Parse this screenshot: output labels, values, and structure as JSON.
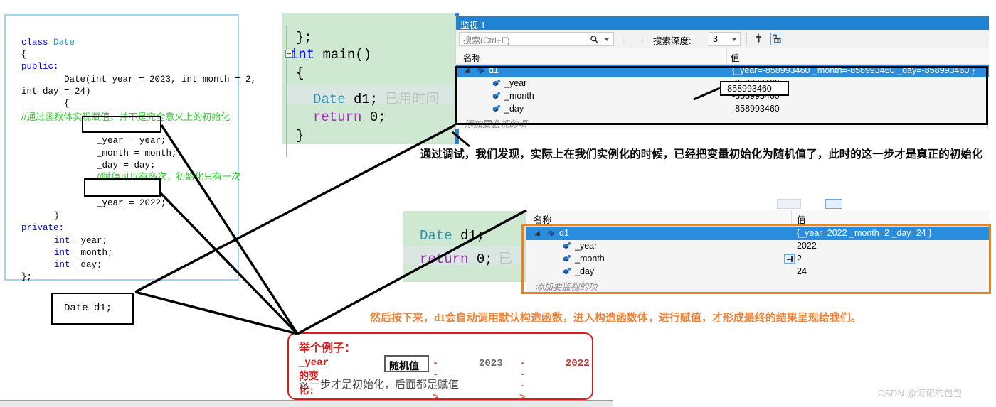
{
  "code_left": {
    "line1_kw": "class",
    "line1_type": " Date",
    "line2": "{",
    "line3": "public:",
    "line4": "        Date(int year = 2023, int month = 2,",
    "line5": "int day = 24)",
    "line6": "        {",
    "comment1": "//通过函数体实现赋值，并不是完全意义上的初始化",
    "assign_year": "_year = year;",
    "assign_month": "_month = month;",
    "assign_day": "_day = day;",
    "comment2": "//赋值可以有多次，初始化只有一次",
    "assign_year2": "_year = 2022;",
    "close_brace": "}",
    "private_label": "private:",
    "member1": "int _year;",
    "member2": "int _month;",
    "member3": "int _day;",
    "end": "};"
  },
  "date_box": {
    "text": "Date d1;"
  },
  "code_mid_top": {
    "l1": "};",
    "l2_kw": "int",
    "l2_name": " main()",
    "l3": "{",
    "l4_type": "Date",
    "l4_var": " d1;",
    "l4_hint": "已用时间",
    "l5_kw": "return",
    "l5_rest": " 0;",
    "l6": "}"
  },
  "code_mid_bottom": {
    "l1_type": "Date",
    "l1_var": " d1;",
    "l2_kw": "return",
    "l2_rest": " 0;",
    "l2_hint": "已"
  },
  "watch1": {
    "title": "监视 1",
    "search_placeholder": "搜索(Ctrl+E)",
    "depth_label": "搜索深度:",
    "depth_value": "3",
    "col_name": "名称",
    "col_value": "值",
    "add_watch_hint": "添加要监视的项",
    "highlight_value": "-858993460",
    "rows": [
      {
        "name": "d1",
        "value": "{_year=-858993460 _month=-858993460 _day=-858993460 }"
      },
      {
        "name": "_year",
        "value": "-858993460"
      },
      {
        "name": "_month",
        "value": "-858993460"
      },
      {
        "name": "_day",
        "value": "-858993460"
      }
    ]
  },
  "watch2": {
    "col_name": "名称",
    "col_value": "值",
    "add_watch_hint": "添加要监视的项",
    "rows": [
      {
        "name": "d1",
        "value": "{_year=2022 _month=2 _day=24 }"
      },
      {
        "name": "_year",
        "value": "2022"
      },
      {
        "name": "_month",
        "value": "2"
      },
      {
        "name": "_day",
        "value": "24"
      }
    ]
  },
  "notes": {
    "middle": "通过调试，我们发现，实际上在我们实例化的时候，已经把变量初始化为随机值了，此时的这一步才是真正的初始化",
    "orange": "然后按下来，d1会自动调用默认构造函数，进入构造函数体，进行赋值，才形成最终的结果呈现给我们。"
  },
  "example_box": {
    "title": "举个例子：",
    "year_label": "_year的变化:",
    "random_value": "随机值",
    "arrow1": "--->",
    "value1": "2023",
    "arrow2": "--->",
    "value2": "2022",
    "footer": "这一步才是初始化，后面都是赋值"
  },
  "watermark": "CSDN @诺诺的包包",
  "colors": {
    "watch_title_bg": "#1f82d2",
    "row_selected": "#2a8cdd",
    "code_green_bg": "#cfe8d2",
    "left_panel_border": "#9fd8e8",
    "orange_emphasis": "#e8821a",
    "red_box": "#e01a1a",
    "orange_note": "#ef8438",
    "comment_green": "#33cc33"
  }
}
